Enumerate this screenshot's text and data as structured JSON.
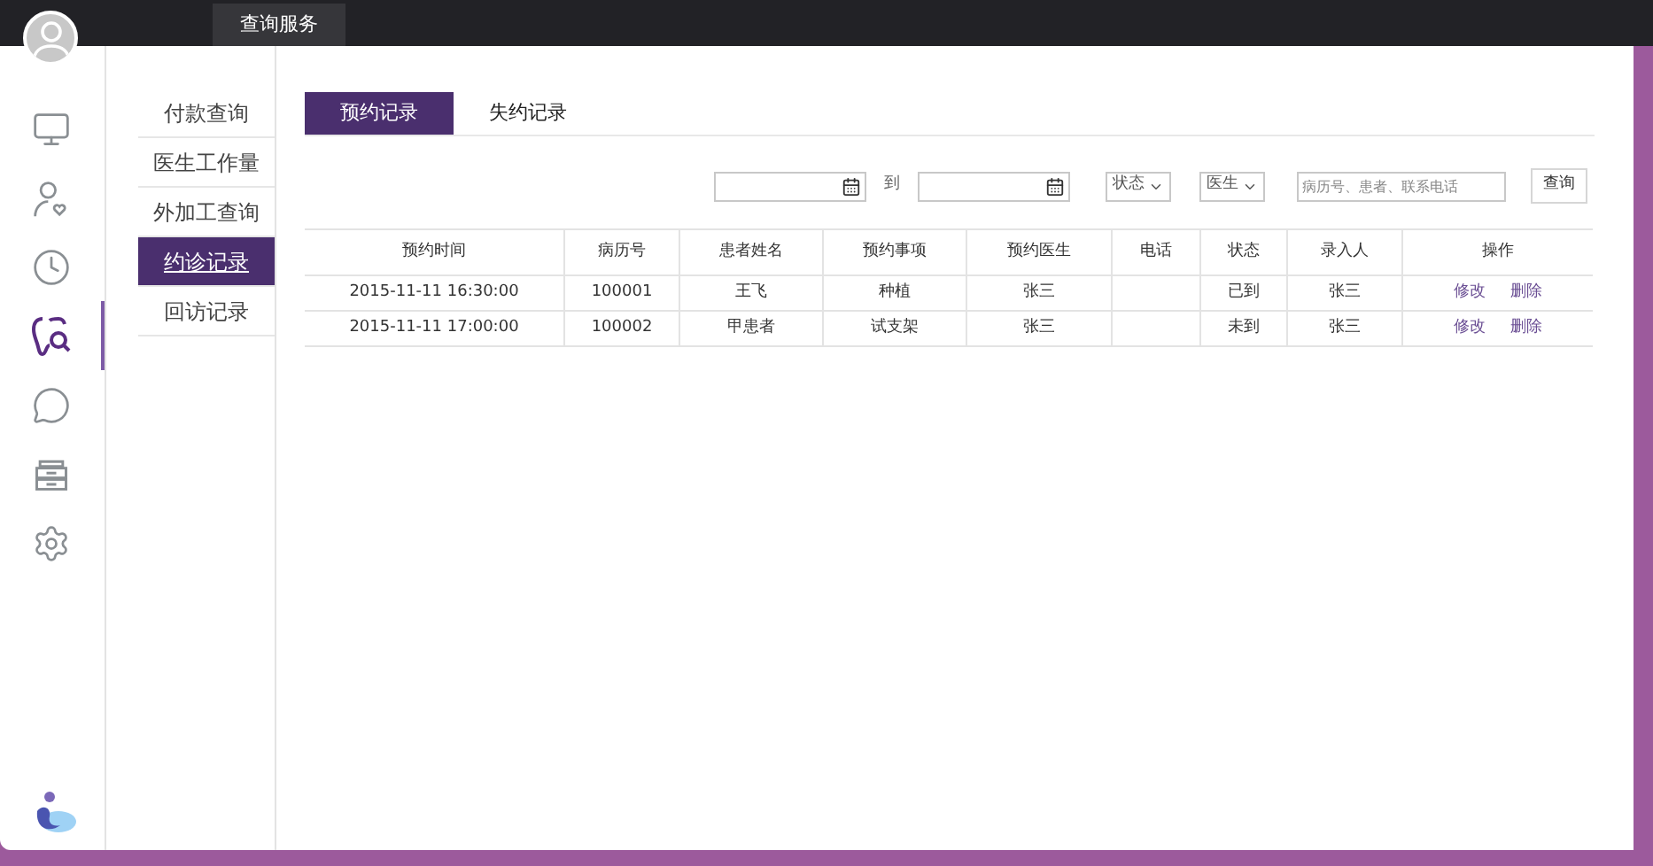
{
  "top_bar": {
    "tab": "查询服务"
  },
  "rail": [
    {
      "kind": "monitor",
      "selected": false
    },
    {
      "kind": "user-heart",
      "selected": false
    },
    {
      "kind": "clock",
      "selected": false
    },
    {
      "kind": "tooth",
      "selected": true
    },
    {
      "kind": "chat",
      "selected": false
    },
    {
      "kind": "drawer",
      "selected": false
    },
    {
      "kind": "settings",
      "selected": false
    }
  ],
  "submenu": [
    {
      "label": "付款查询",
      "selected": false
    },
    {
      "label": "医生工作量",
      "selected": false
    },
    {
      "label": "外加工查询",
      "selected": false
    },
    {
      "label": "约诊记录",
      "selected": true
    },
    {
      "label": "回访记录",
      "selected": false
    }
  ],
  "tabs": [
    {
      "label": "预约记录",
      "selected": true
    },
    {
      "label": "失约记录",
      "selected": false
    }
  ],
  "filters": {
    "to_label": "到",
    "status_select": "状态",
    "doctor_select": "医生",
    "search": {
      "placeholder": "病历号、患者、联系电话"
    },
    "query_button": "查询"
  },
  "table": {
    "columns": [
      "预约时间",
      "病历号",
      "患者姓名",
      "预约事项",
      "预约医生",
      "电话",
      "状态",
      "录入人",
      "操作"
    ],
    "rows": [
      {
        "cells": [
          "2015-11-11 16:30:00",
          "100001",
          "王飞",
          "种植",
          "张三",
          "",
          "已到",
          "张三"
        ],
        "actions": [
          "修改",
          "删除"
        ]
      },
      {
        "cells": [
          "2015-11-11 17:00:00",
          "100002",
          "甲患者",
          "试支架",
          "张三",
          "",
          "未到",
          "张三"
        ],
        "actions": [
          "修改",
          "删除"
        ]
      }
    ]
  }
}
